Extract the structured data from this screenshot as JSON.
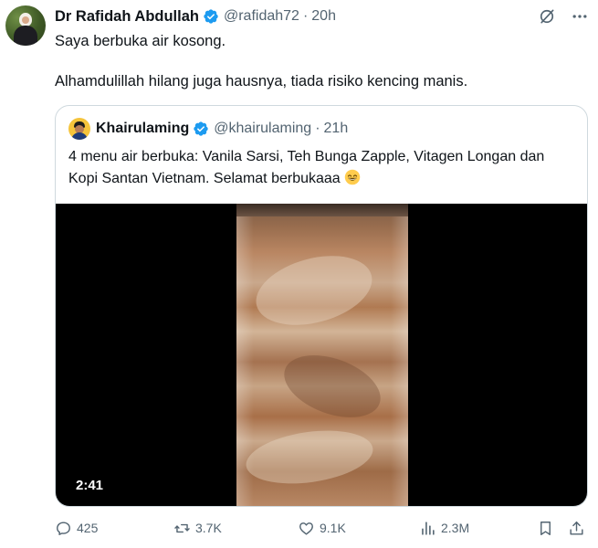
{
  "author": {
    "display_name": "Dr Rafidah Abdullah",
    "handle": "@rafidah72",
    "separator": "·",
    "time": "20h"
  },
  "tweet": {
    "line1": "Saya berbuka air kosong.",
    "line2": "Alhamdulillah hilang juga hausnya, tiada risiko kencing manis."
  },
  "quoted": {
    "display_name": "Khairulaming",
    "handle": "@khairulaming",
    "separator": "·",
    "time": "21h",
    "text": "4 menu air berbuka: Vanila Sarsi, Teh Bunga Zapple, Vitagen Longan dan Kopi Santan Vietnam. Selamat berbukaaa",
    "emoji": "grinning-face-emoji",
    "video_duration": "2:41"
  },
  "actions": {
    "replies": "425",
    "reposts": "3.7K",
    "likes": "9.1K",
    "views": "2.3M"
  },
  "colors": {
    "verified": "#1d9bf0",
    "muted": "#536471",
    "border": "#cfd9de",
    "text": "#0f1419"
  },
  "icons": [
    "verified-icon",
    "grok-icon",
    "more-icon",
    "reply-icon",
    "repost-icon",
    "like-icon",
    "views-icon",
    "bookmark-icon",
    "share-icon"
  ]
}
